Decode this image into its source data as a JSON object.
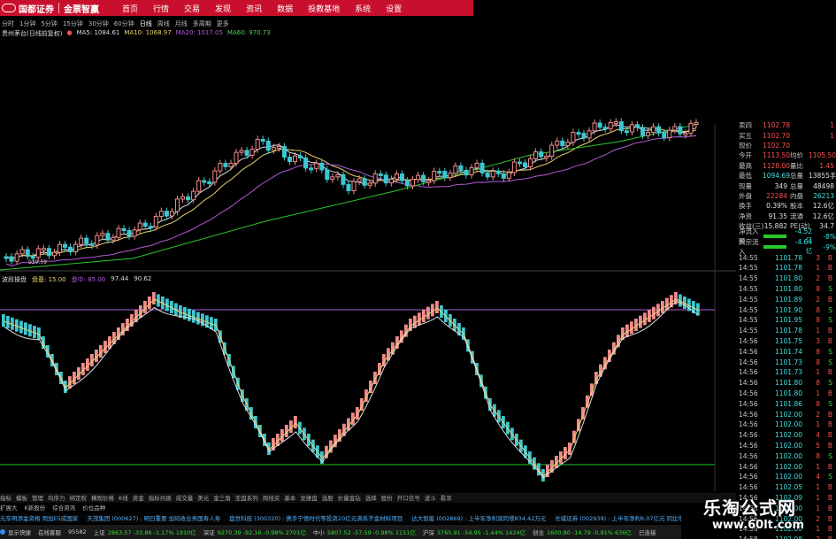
{
  "brand": {
    "name": "国都证券",
    "product": "金票智赢"
  },
  "menu": [
    "首页",
    "行情",
    "交易",
    "发现",
    "资讯",
    "数据",
    "投教基地",
    "系统",
    "设置"
  ],
  "periods": [
    "分时",
    "1分钟",
    "5分钟",
    "15分钟",
    "30分钟",
    "60分钟",
    "日线",
    "周线",
    "月线",
    "多周期",
    "更多"
  ],
  "stock_legend": {
    "name": "贵州茅台(日线前复权)",
    "ma5": "MA5: 1084.61",
    "ma10": "MA10: 1068.97",
    "ma20": "MA20: 1017.05",
    "ma60": "MA60: 970.73"
  },
  "price_labels": {
    "low_marker": "939.59"
  },
  "right_panel": {
    "quotes": [
      {
        "l": "卖四",
        "v": "1102.78",
        "l2": "",
        "v2": "1",
        "c": "red"
      },
      {
        "l": "买五",
        "v": "1102.70",
        "l2": "",
        "v2": "1",
        "c": "red"
      },
      {
        "l": "现价",
        "v": "1102.70",
        "l2": "",
        "v2": "",
        "c": "red"
      }
    ],
    "stats": [
      {
        "l": "今开",
        "v": "1113.50",
        "l2": "均价",
        "v2": "1105.50",
        "c1": "red",
        "c2": "red"
      },
      {
        "l": "最高",
        "v": "1128.00",
        "l2": "量比",
        "v2": "1.45",
        "c1": "red",
        "c2": "red"
      },
      {
        "l": "最低",
        "v": "1094.69",
        "l2": "总量",
        "v2": "13855手",
        "c1": "cyan",
        "c2": "white"
      },
      {
        "l": "现量",
        "v": "349",
        "l2": "总量",
        "v2": "48498",
        "c1": "white",
        "c2": "white"
      },
      {
        "l": "外盘",
        "v": "22284",
        "l2": "内盘",
        "v2": "26213",
        "c1": "red",
        "c2": "cyan"
      },
      {
        "l": "换手",
        "v": "0.39%",
        "l2": "股本",
        "v2": "12.6亿",
        "c1": "white",
        "c2": "white"
      },
      {
        "l": "净资",
        "v": "91.35",
        "l2": "流通",
        "v2": "12.6亿",
        "c1": "white",
        "c2": "white"
      },
      {
        "l": "收益(三)",
        "v": "15.882",
        "l2": "PE(动)",
        "v2": "34.7",
        "c1": "white",
        "c2": "white"
      }
    ],
    "flows": [
      {
        "l": "净流入额",
        "v": "-4.52亿",
        "p": "-8%"
      },
      {
        "l": "大宗流入",
        "v": "-4.64亿",
        "p": "-9%"
      }
    ],
    "ticks": [
      {
        "t": "14:55",
        "p": "1101.78",
        "v": "3",
        "d": "B"
      },
      {
        "t": "14:55",
        "p": "1101.78",
        "v": "1",
        "d": "B"
      },
      {
        "t": "14:55",
        "p": "1101.80",
        "v": "2",
        "d": "B"
      },
      {
        "t": "14:55",
        "p": "1101.80",
        "v": "8",
        "d": "S"
      },
      {
        "t": "14:55",
        "p": "1101.89",
        "v": "2",
        "d": "B"
      },
      {
        "t": "14:55",
        "p": "1101.90",
        "v": "8",
        "d": "S"
      },
      {
        "t": "14:55",
        "p": "1101.95",
        "v": "8",
        "d": "S"
      },
      {
        "t": "14:55",
        "p": "1101.78",
        "v": "1",
        "d": "B"
      },
      {
        "t": "14:56",
        "p": "1101.75",
        "v": "3",
        "d": "B"
      },
      {
        "t": "14:56",
        "p": "1101.74",
        "v": "8",
        "d": "S"
      },
      {
        "t": "14:56",
        "p": "1101.73",
        "v": "8",
        "d": "S"
      },
      {
        "t": "14:56",
        "p": "1101.73",
        "v": "1",
        "d": "B"
      },
      {
        "t": "14:56",
        "p": "1101.80",
        "v": "8",
        "d": "S"
      },
      {
        "t": "14:56",
        "p": "1101.80",
        "v": "1",
        "d": "B"
      },
      {
        "t": "14:56",
        "p": "1101.86",
        "v": "8",
        "d": "S"
      },
      {
        "t": "14:56",
        "p": "1102.00",
        "v": "2",
        "d": "B"
      },
      {
        "t": "14:56",
        "p": "1102.00",
        "v": "1",
        "d": "B"
      },
      {
        "t": "14:56",
        "p": "1102.00",
        "v": "4",
        "d": "B"
      },
      {
        "t": "14:56",
        "p": "1102.00",
        "v": "5",
        "d": "B"
      },
      {
        "t": "14:56",
        "p": "1102.00",
        "v": "8",
        "d": "S"
      },
      {
        "t": "14:56",
        "p": "1102.00",
        "v": "1",
        "d": "B"
      },
      {
        "t": "14:56",
        "p": "1102.00",
        "v": "4",
        "d": "S"
      },
      {
        "t": "14:56",
        "p": "1102.05",
        "v": "1",
        "d": "B"
      },
      {
        "t": "14:56",
        "p": "1102.09",
        "v": "1",
        "d": "B"
      },
      {
        "t": "14:56",
        "p": "1102.00",
        "v": "1",
        "d": "B"
      },
      {
        "t": "14:56",
        "p": "1102.00",
        "v": "2",
        "d": "B"
      },
      {
        "t": "14:56",
        "p": "1102.00",
        "v": "1",
        "d": "B"
      },
      {
        "t": "14:58",
        "p": "1102.08",
        "v": "2",
        "d": "B"
      },
      {
        "t": "14:58",
        "p": "1102.09",
        "v": "8",
        "d": "S"
      }
    ]
  },
  "indicator_legend": {
    "name": "波段操盘",
    "a": "盘基: 15.00",
    "b": "盘中: 85.00",
    "c": "97.44",
    "d": "90.62"
  },
  "tabs": [
    "指标",
    "模板",
    "管理",
    "均序力",
    "绑定权",
    "横观价格",
    "K线",
    "资金",
    "指标共振",
    "成交量",
    "美元",
    "金三角",
    "亚盘系列",
    "周线买",
    "基本",
    "龙操盘",
    "选股",
    "价量金钻",
    "选择",
    "股份",
    "开口信号",
    "波斗",
    "看吊"
  ],
  "subtabs": [
    "扩展大",
    "K新股份",
    "综合资讯",
    "价位品种"
  ],
  "ticker": [
    "元车明添金资格 用加E5成国家",
    "天茂集团 (000627) : 明日重要 加码收业务国寿人寿",
    "盘世科技 (300320) : 携手宁德时代等投资20亿元满系齐金材料项目",
    "达大智能 (002869) : 上半年净利润同增834.42万元",
    "长城证券 (002939) : 上半年净利6.07亿元 同比增长"
  ],
  "statusbar": [
    {
      "l": "显示快捷",
      "v": "",
      "c": ""
    },
    {
      "l": "在线客服",
      "v": "",
      "c": ""
    },
    {
      "l": "95582",
      "v": "",
      "c": ""
    },
    {
      "l": "上证",
      "v": "2863.57 -33.86 -1.17% 1910亿",
      "c": "green"
    },
    {
      "l": "深证",
      "v": "9270.39 -92.16 -0.98% 2701亿",
      "c": "green"
    },
    {
      "l": "中小",
      "v": "5807.52 -57.59 -0.98% 1151亿",
      "c": "green"
    },
    {
      "l": "沪深",
      "v": "3765.91 -54.95 -1.44% 1424亿",
      "c": "green"
    },
    {
      "l": "创业",
      "v": "1600.80 -14.79 -0.91% 636亿",
      "c": "green"
    },
    {
      "l": "已连接",
      "v": "",
      "c": ""
    }
  ],
  "watermark": {
    "title": "乐淘公式网",
    "url": "www.60lt.com"
  },
  "colors": {
    "up": "#f08a8a",
    "down": "#3cc6d0",
    "ma5": "#e0e0e0",
    "ma10": "#e8d36a",
    "ma20": "#b15bd6",
    "ma60": "#29c829",
    "accent": "#c8102e"
  }
}
